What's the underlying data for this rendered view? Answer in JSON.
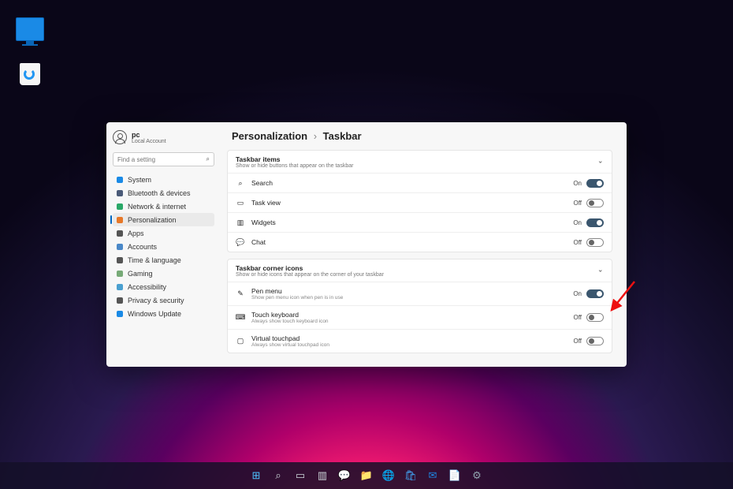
{
  "desktop": {
    "monitor_icon": "This PC",
    "recycle_icon": "Recycle Bin"
  },
  "user": {
    "name": "pc",
    "sub": "Local Account"
  },
  "search": {
    "placeholder": "Find a setting"
  },
  "nav": [
    {
      "label": "System",
      "color": "#1a8ae6"
    },
    {
      "label": "Bluetooth & devices",
      "color": "#4a5a78"
    },
    {
      "label": "Network & internet",
      "color": "#2aa868"
    },
    {
      "label": "Personalization",
      "color": "#e77828",
      "selected": true
    },
    {
      "label": "Apps",
      "color": "#555"
    },
    {
      "label": "Accounts",
      "color": "#4a88c8"
    },
    {
      "label": "Time & language",
      "color": "#555"
    },
    {
      "label": "Gaming",
      "color": "#7a7"
    },
    {
      "label": "Accessibility",
      "color": "#4aa0d0"
    },
    {
      "label": "Privacy & security",
      "color": "#555"
    },
    {
      "label": "Windows Update",
      "color": "#1a8ae6"
    }
  ],
  "breadcrumb": {
    "parent": "Personalization",
    "current": "Taskbar"
  },
  "group1": {
    "title": "Taskbar items",
    "sub": "Show or hide buttons that appear on the taskbar",
    "rows": [
      {
        "icon": "search-icon",
        "label": "Search",
        "state": "On",
        "on": true
      },
      {
        "icon": "taskview-icon",
        "label": "Task view",
        "state": "Off",
        "on": false
      },
      {
        "icon": "widgets-icon",
        "label": "Widgets",
        "state": "On",
        "on": true
      },
      {
        "icon": "chat-icon",
        "label": "Chat",
        "state": "Off",
        "on": false
      }
    ]
  },
  "group2": {
    "title": "Taskbar corner icons",
    "sub": "Show or hide icons that appear on the corner of your taskbar",
    "rows": [
      {
        "icon": "pen-icon",
        "label": "Pen menu",
        "sub": "Show pen menu icon when pen is in use",
        "state": "On",
        "on": true
      },
      {
        "icon": "keyboard-icon",
        "label": "Touch keyboard",
        "sub": "Always show touch keyboard icon",
        "state": "Off",
        "on": false
      },
      {
        "icon": "touchpad-icon",
        "label": "Virtual touchpad",
        "sub": "Always show virtual touchpad icon",
        "state": "Off",
        "on": false
      }
    ]
  },
  "taskbar_apps": [
    "start-icon",
    "search-icon",
    "taskview-icon",
    "widgets-icon",
    "chat-icon",
    "explorer-icon",
    "edge-icon",
    "store-icon",
    "mail-icon",
    "word-icon",
    "settings-icon"
  ]
}
